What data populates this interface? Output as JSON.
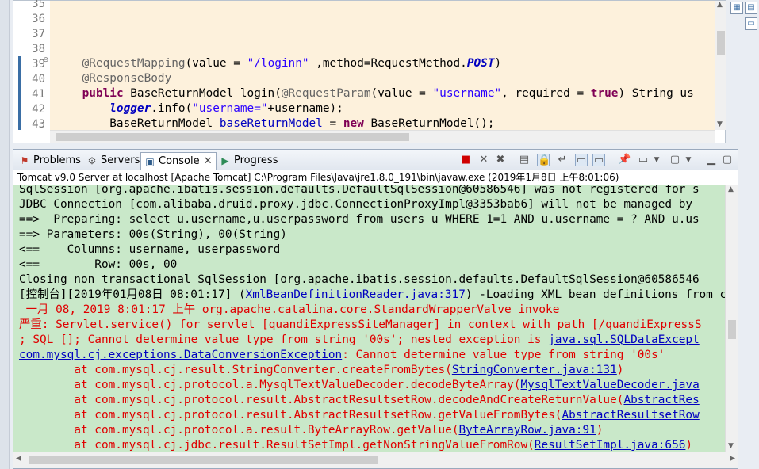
{
  "editor": {
    "lines": [
      {
        "num": "35"
      },
      {
        "num": "36"
      },
      {
        "num": "37"
      },
      {
        "num": "38"
      },
      {
        "num": "39",
        "a": "@RequestMapping",
        "b": "(value = ",
        "c": "\"/loginn\"",
        "d": " ,method=RequestMethod.",
        "e": "POST",
        "f": ")"
      },
      {
        "num": "40",
        "a": "@ResponseBody"
      },
      {
        "num": "41",
        "kw": "public",
        "b": " BaseReturnModel login(",
        "a": "@RequestParam",
        "c": "(value = ",
        "d": "\"username\"",
        "e": ", required = ",
        "kw2": "true",
        "f": ") String us"
      },
      {
        "num": "42",
        "fld": "logger",
        "b": ".info(",
        "d": "\"username=\"",
        "f": "+username);"
      },
      {
        "num": "43",
        "b": "BaseReturnModel ",
        "c": "baseReturnModel",
        "d": " = ",
        "kw": "new",
        "f": " BaseReturnModel();"
      }
    ]
  },
  "console": {
    "tabs": [
      {
        "label": "Problems",
        "icon": "problems-icon"
      },
      {
        "label": "Servers",
        "icon": "servers-icon"
      },
      {
        "label": "Console",
        "icon": "console-icon"
      },
      {
        "label": "Progress",
        "icon": "progress-icon"
      }
    ],
    "close_glyph": "✕",
    "info": "Tomcat v9.0 Server at localhost [Apache Tomcat] C:\\Program Files\\Java\\jre1.8.0_191\\bin\\javaw.exe (2019年1月8日 上午8:01:06)",
    "lines": [
      {
        "t": "SqlSession [org.apache.ibatis.session.defaults.DefaultSqlSession@60586546] was not registered for s"
      },
      {
        "t": "JDBC Connection [com.alibaba.druid.proxy.jdbc.ConnectionProxyImpl@3353bab6] will not be managed by"
      },
      {
        "t": "==>  Preparing: select u.username,u.userpassword from users u WHERE 1=1 AND u.username = ? AND u.us"
      },
      {
        "t": "==> Parameters: 00s(String), 00(String)"
      },
      {
        "t": "<==    Columns: username, userpassword"
      },
      {
        "t": "<==        Row: 00s, 00"
      },
      {
        "t": "Closing non transactional SqlSession [org.apache.ibatis.session.defaults.DefaultSqlSession@60586546"
      },
      {
        "t": "[控制台][2019年01月08日 08:01:17] (",
        "link": "XmlBeanDefinitionReader.java:317",
        "t2": ") -Loading XML bean definitions from c"
      },
      {
        "red": " 一月 08, 2019 8:01:17 上午 org.apache.catalina.core.StandardWrapperValve invoke"
      },
      {
        "red": "严重: Servlet.service() for servlet [quandiExpressSiteManager] in context with path [/quandiExpressS"
      },
      {
        "red": "; SQL []; Cannot determine value type from string '00s'; nested exception is ",
        "link": "java.sql.SQLDataExcept"
      },
      {
        "link": "com.mysql.cj.exceptions.DataConversionException",
        "red2": ": Cannot determine value type from string '00s'"
      },
      {
        "red": "\tat com.mysql.cj.result.StringConverter.createFromBytes(",
        "link": "StringConverter.java:131",
        "red2": ")"
      },
      {
        "red": "\tat com.mysql.cj.protocol.a.MysqlTextValueDecoder.decodeByteArray(",
        "link": "MysqlTextValueDecoder.java"
      },
      {
        "red": "\tat com.mysql.cj.protocol.result.AbstractResultsetRow.decodeAndCreateReturnValue(",
        "link": "AbstractRes"
      },
      {
        "red": "\tat com.mysql.cj.protocol.result.AbstractResultsetRow.getValueFromBytes(",
        "link": "AbstractResultsetRow"
      },
      {
        "red": "\tat com.mysql.cj.protocol.a.result.ByteArrayRow.getValue(",
        "link": "ByteArrayRow.java:91",
        "red2": ")"
      },
      {
        "red": "\tat com.mysql.cj.jdbc.result.ResultSetImpl.getNonStringValueFromRow(",
        "link": "ResultSetImpl.java:656",
        "red2": ")"
      }
    ]
  }
}
